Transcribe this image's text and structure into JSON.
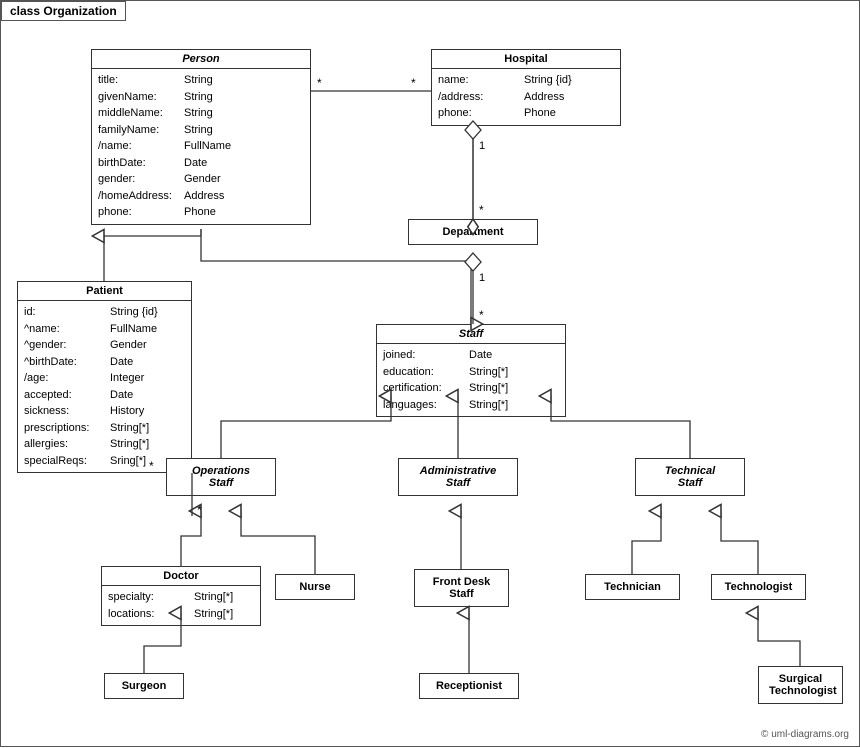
{
  "title": "class Organization",
  "classes": {
    "person": {
      "name": "Person",
      "attrs": [
        {
          "name": "title:",
          "type": "String"
        },
        {
          "name": "givenName:",
          "type": "String"
        },
        {
          "name": "middleName:",
          "type": "String"
        },
        {
          "name": "familyName:",
          "type": "String"
        },
        {
          "name": "/name:",
          "type": "FullName"
        },
        {
          "name": "birthDate:",
          "type": "Date"
        },
        {
          "name": "gender:",
          "type": "Gender"
        },
        {
          "name": "/homeAddress:",
          "type": "Address"
        },
        {
          "name": "phone:",
          "type": "Phone"
        }
      ]
    },
    "hospital": {
      "name": "Hospital",
      "attrs": [
        {
          "name": "name:",
          "type": "String {id}"
        },
        {
          "name": "/address:",
          "type": "Address"
        },
        {
          "name": "phone:",
          "type": "Phone"
        }
      ]
    },
    "patient": {
      "name": "Patient",
      "attrs": [
        {
          "name": "id:",
          "type": "String {id}"
        },
        {
          "name": "^name:",
          "type": "FullName"
        },
        {
          "name": "^gender:",
          "type": "Gender"
        },
        {
          "name": "^birthDate:",
          "type": "Date"
        },
        {
          "name": "/age:",
          "type": "Integer"
        },
        {
          "name": "accepted:",
          "type": "Date"
        },
        {
          "name": "sickness:",
          "type": "History"
        },
        {
          "name": "prescriptions:",
          "type": "String[*]"
        },
        {
          "name": "allergies:",
          "type": "String[*]"
        },
        {
          "name": "specialReqs:",
          "type": "Sring[*]"
        }
      ]
    },
    "department": {
      "name": "Department"
    },
    "staff": {
      "name": "Staff",
      "attrs": [
        {
          "name": "joined:",
          "type": "Date"
        },
        {
          "name": "education:",
          "type": "String[*]"
        },
        {
          "name": "certification:",
          "type": "String[*]"
        },
        {
          "name": "languages:",
          "type": "String[*]"
        }
      ]
    },
    "operations_staff": {
      "name": "Operations\nStaff"
    },
    "administrative_staff": {
      "name": "Administrative\nStaff"
    },
    "technical_staff": {
      "name": "Technical\nStaff"
    },
    "doctor": {
      "name": "Doctor",
      "attrs": [
        {
          "name": "specialty:",
          "type": "String[*]"
        },
        {
          "name": "locations:",
          "type": "String[*]"
        }
      ]
    },
    "nurse": {
      "name": "Nurse"
    },
    "front_desk_staff": {
      "name": "Front Desk\nStaff"
    },
    "technician": {
      "name": "Technician"
    },
    "technologist": {
      "name": "Technologist"
    },
    "surgeon": {
      "name": "Surgeon"
    },
    "receptionist": {
      "name": "Receptionist"
    },
    "surgical_technologist": {
      "name": "Surgical\nTechnologist"
    }
  },
  "copyright": "© uml-diagrams.org"
}
